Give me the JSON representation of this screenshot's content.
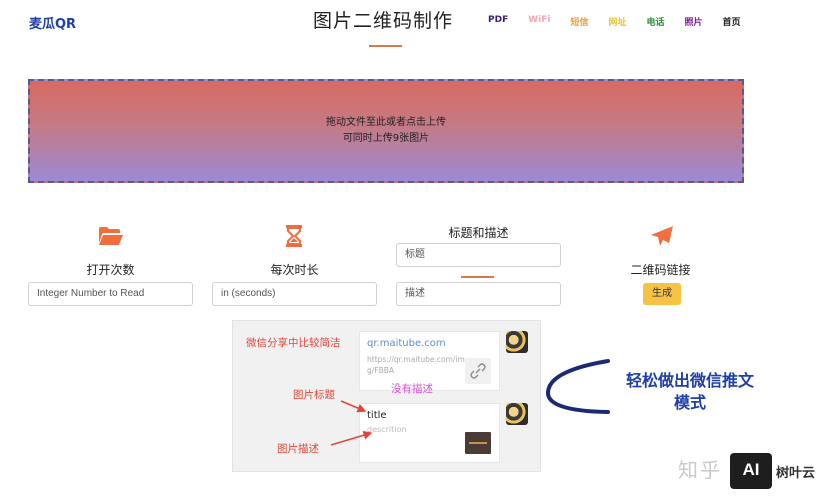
{
  "header": {
    "brand": "麦瓜QR",
    "title": "图片二维码制作",
    "nav": [
      {
        "label": "PDF",
        "color": "#3a1f6e"
      },
      {
        "label": "WiFi",
        "color": "#f0a7b3"
      },
      {
        "label": "短信",
        "color": "#e8a33a"
      },
      {
        "label": "网址",
        "color": "#e8c53a"
      },
      {
        "label": "电话",
        "color": "#2e8b3a"
      },
      {
        "label": "照片",
        "color": "#7a1f8a"
      },
      {
        "label": "首页",
        "color": "#222222"
      }
    ]
  },
  "upload": {
    "line1": "拖动文件至此或者点击上传",
    "line2": "可同时上传9张图片"
  },
  "options": {
    "reads": {
      "label": "打开次数",
      "placeholder": "Integer Number to Read",
      "icon": "folder-open-icon"
    },
    "duration": {
      "label": "每次时长",
      "placeholder": "in (seconds)",
      "icon": "hourglass-icon"
    },
    "meta": {
      "label": "标题和描述",
      "title_placeholder": "标题",
      "desc_placeholder": "描述"
    },
    "link": {
      "label": "二维码链接",
      "button": "生成",
      "icon": "paper-plane-icon"
    }
  },
  "demo": {
    "wechat_note": "微信分享中比较简洁",
    "domain": "qr.maitube.com",
    "url": "https://qr.maitube.com/img/FBBA",
    "no_desc": "没有描述",
    "img_title_label": "图片标题",
    "card_title": "title",
    "card_desc": "descrition",
    "img_desc_label": "图片描述"
  },
  "caption": {
    "line1": "轻松做出微信推文",
    "line2": "模式"
  },
  "watermark": {
    "text": "知乎",
    "badge": "AI",
    "brand": "树叶云"
  },
  "colors": {
    "accent": "#f26d3d",
    "brand": "#1f3fa8",
    "button": "#f6c244",
    "annotation": "#e0473a"
  }
}
